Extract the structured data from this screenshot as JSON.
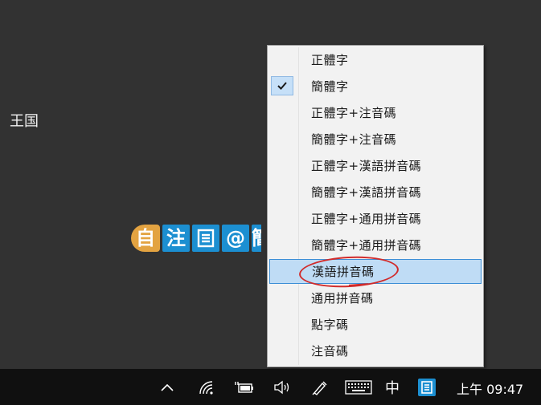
{
  "desktop": {
    "label": "王国"
  },
  "ime_toolbar": {
    "mode_label": "自",
    "phonetic_label": "注",
    "fullwidth_label": "@",
    "partial_label": "簡"
  },
  "menu": {
    "items": [
      {
        "label": "正體字",
        "checked": false,
        "highlighted": false
      },
      {
        "label": "簡體字",
        "checked": true,
        "highlighted": false
      },
      {
        "label": "正體字+注音碼",
        "checked": false,
        "highlighted": false
      },
      {
        "label": "簡體字+注音碼",
        "checked": false,
        "highlighted": false
      },
      {
        "label": "正體字+漢語拼音碼",
        "checked": false,
        "highlighted": false
      },
      {
        "label": "簡體字+漢語拼音碼",
        "checked": false,
        "highlighted": false
      },
      {
        "label": "正體字+通用拼音碼",
        "checked": false,
        "highlighted": false
      },
      {
        "label": "簡體字+通用拼音碼",
        "checked": false,
        "highlighted": false
      },
      {
        "label": "漢語拼音碼",
        "checked": false,
        "highlighted": true
      },
      {
        "label": "通用拼音碼",
        "checked": false,
        "highlighted": false
      },
      {
        "label": "點字碼",
        "checked": false,
        "highlighted": false
      },
      {
        "label": "注音碼",
        "checked": false,
        "highlighted": false
      }
    ]
  },
  "taskbar": {
    "icons": [
      "chevron-up-icon",
      "wifi-icon",
      "battery-plug-icon",
      "volume-icon",
      "pen-icon",
      "keyboard-icon"
    ],
    "input_language": "中",
    "clock": "上午 09:47"
  },
  "colors": {
    "desktop_bg": "#323232",
    "taskbar_bg": "#101010",
    "ime_blue": "#1c8fd1",
    "ime_orange": "#e3a341",
    "menu_highlight": "#bfdcf5",
    "annotation_red": "#d12b2b"
  }
}
